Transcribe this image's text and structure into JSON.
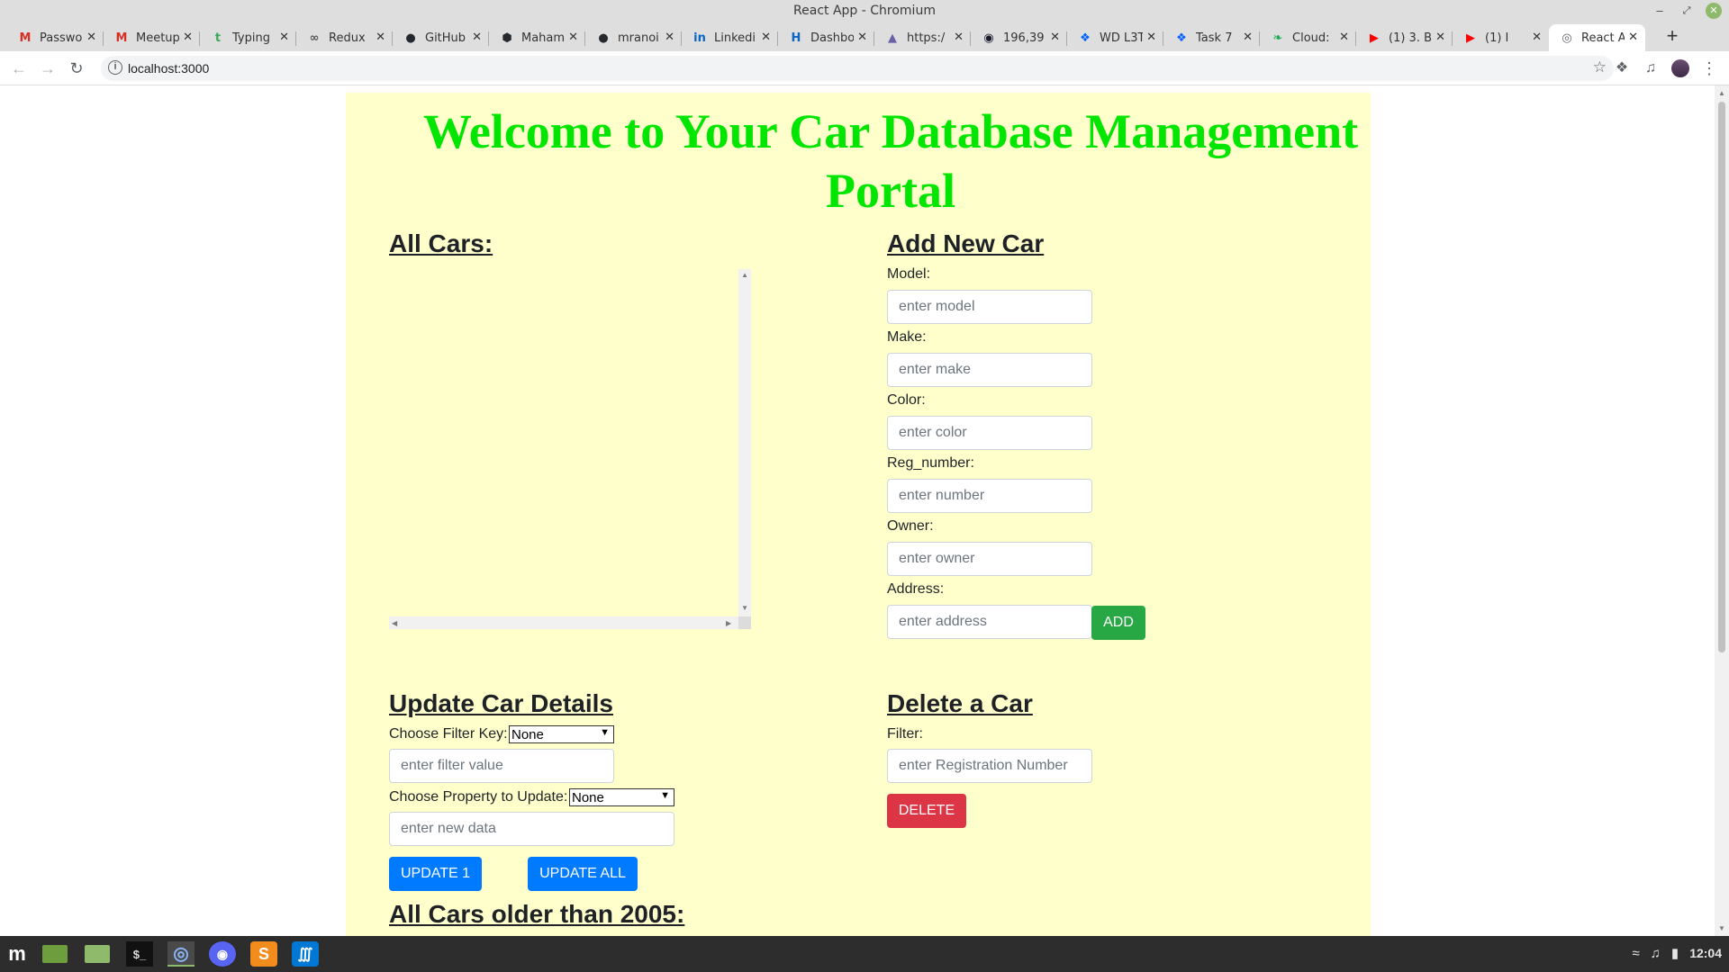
{
  "window": {
    "title": "React App - Chromium"
  },
  "tabs": [
    {
      "label": "Passwo",
      "icon": "gmail-icon",
      "glyph": "M",
      "color": "#d93025"
    },
    {
      "label": "Meetup",
      "icon": "gmail-icon",
      "glyph": "M",
      "color": "#d93025"
    },
    {
      "label": "Typing",
      "icon": "typing-icon",
      "glyph": "t",
      "color": "#3aa757"
    },
    {
      "label": "Redux",
      "icon": "glasses-icon",
      "glyph": "∞",
      "color": "#555555"
    },
    {
      "label": "GitHub",
      "icon": "github-icon",
      "glyph": "●",
      "color": "#24292e"
    },
    {
      "label": "Maham",
      "icon": "codesandbox-icon",
      "glyph": "⬢",
      "color": "#24292e"
    },
    {
      "label": "mranoi",
      "icon": "github-icon",
      "glyph": "●",
      "color": "#24292e"
    },
    {
      "label": "Linkedi",
      "icon": "linkedin-icon",
      "glyph": "in",
      "color": "#0a66c2"
    },
    {
      "label": "Dashbo",
      "icon": "dashboard-icon",
      "glyph": "H",
      "color": "#0a66c2"
    },
    {
      "label": "https:/",
      "icon": "heroku-icon",
      "glyph": "▲",
      "color": "#6762a6"
    },
    {
      "label": "196,39",
      "icon": "circle-icon",
      "glyph": "◉",
      "color": "#1a1a2e"
    },
    {
      "label": "WD L3T",
      "icon": "dropbox-icon",
      "glyph": "❖",
      "color": "#0061fe"
    },
    {
      "label": "Task 7",
      "icon": "dropbox-icon",
      "glyph": "❖",
      "color": "#0061fe"
    },
    {
      "label": "Cloud:",
      "icon": "mongodb-leaf-icon",
      "glyph": "❧",
      "color": "#13aa52"
    },
    {
      "label": "(1) 3. B",
      "icon": "youtube-icon",
      "glyph": "▶",
      "color": "#ff0000"
    },
    {
      "label": "(1) I",
      "icon": "youtube-icon",
      "glyph": "▶",
      "color": "#ff0000"
    },
    {
      "label": "React A",
      "icon": "globe-icon",
      "glyph": "◎",
      "color": "#5f6368"
    }
  ],
  "address_bar": {
    "url": "localhost:3000"
  },
  "page": {
    "title": "Welcome to Your Car Database Management Portal",
    "all_cars": {
      "heading": "All Cars:"
    },
    "add_car": {
      "heading": "Add New Car",
      "fields": [
        {
          "label": "Model:",
          "placeholder": "enter model"
        },
        {
          "label": "Make:",
          "placeholder": "enter make"
        },
        {
          "label": "Color:",
          "placeholder": "enter color"
        },
        {
          "label": "Reg_number:",
          "placeholder": "enter number"
        },
        {
          "label": "Owner:",
          "placeholder": "enter owner"
        },
        {
          "label": "Address:",
          "placeholder": "enter address"
        }
      ],
      "add_label": "ADD"
    },
    "update": {
      "heading": "Update Car Details",
      "filter_key_label": "Choose Filter Key:",
      "filter_key_value": "None",
      "filter_value_placeholder": "enter filter value",
      "property_label": "Choose Property to Update:",
      "property_value": "None",
      "new_data_placeholder": "enter new data",
      "update_one_label": "UPDATE 1",
      "update_all_label": "UPDATE ALL"
    },
    "delete": {
      "heading": "Delete a Car",
      "filter_label": "Filter:",
      "placeholder": "enter Registration Number",
      "delete_label": "DELETE"
    },
    "older": {
      "heading": "All Cars older than 2005:"
    }
  },
  "colors": {
    "title_green": "#00e600",
    "page_bg": "#ffffcc",
    "add_green": "#28a745",
    "update_blue": "#007bff",
    "delete_red": "#dc3545"
  },
  "taskbar": {
    "items": [
      "mint-menu-icon",
      "show-desktop-icon",
      "files-icon",
      "terminal-icon",
      "chromium-icon",
      "discord-icon",
      "sublime-text-icon",
      "vscode-icon"
    ],
    "clock": "12:04"
  }
}
